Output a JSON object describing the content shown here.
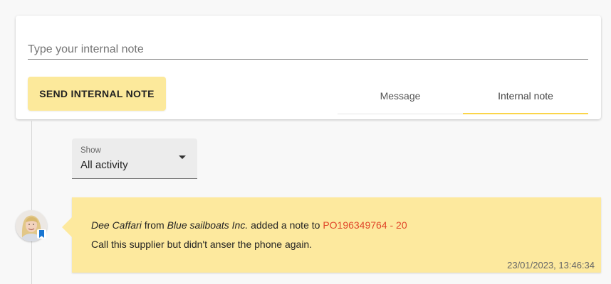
{
  "composer": {
    "placeholder": "Type your internal note",
    "send_label": "SEND INTERNAL NOTE",
    "tabs": [
      {
        "label": "Message",
        "active": false
      },
      {
        "label": "Internal note",
        "active": true
      }
    ]
  },
  "filter": {
    "label": "Show",
    "value": "All activity"
  },
  "activity": {
    "author": "Dee Caffari",
    "from_word": "from",
    "company": "Blue sailboats Inc.",
    "action": "added a note to",
    "reference": "PO196349764 - 20",
    "body": "Call this supplier but didn't anser the phone again.",
    "timestamp": "23/01/2023, 13:46:34",
    "avatar_icon": "user-avatar",
    "badge_icon": "bookmark-icon"
  },
  "colors": {
    "accent": "#fbd54a",
    "button_bg": "#fce99b",
    "note_bg": "#fde99e",
    "link": "#e0472a",
    "badge": "#1976d2"
  }
}
